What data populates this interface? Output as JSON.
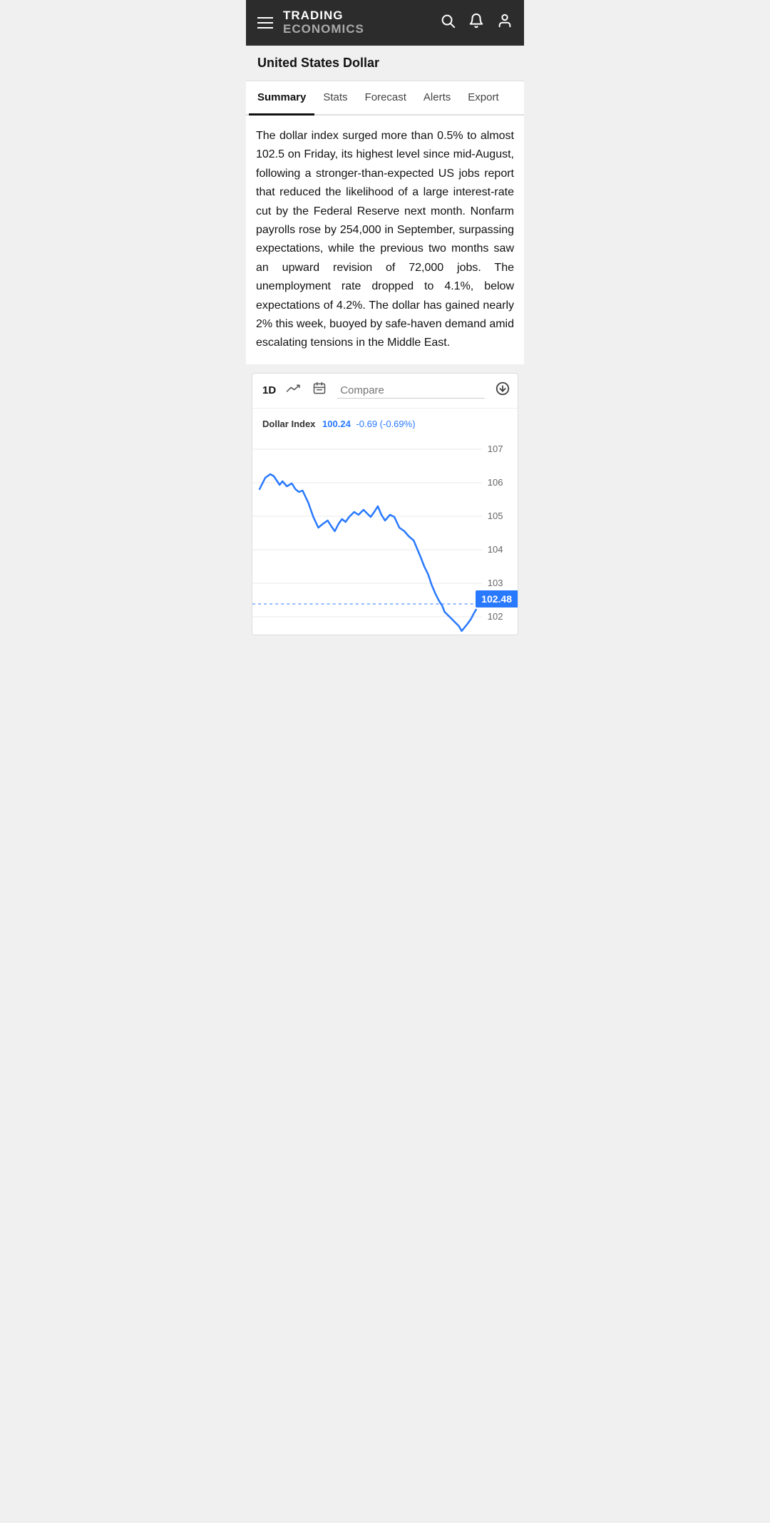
{
  "header": {
    "brand_trading": "TRADING",
    "brand_economics": "ECONOMICS"
  },
  "page": {
    "title": "United States Dollar"
  },
  "tabs": [
    {
      "label": "Summary",
      "active": true
    },
    {
      "label": "Stats",
      "active": false
    },
    {
      "label": "Forecast",
      "active": false
    },
    {
      "label": "Alerts",
      "active": false
    },
    {
      "label": "Export",
      "active": false
    }
  ],
  "summary": {
    "text": "The dollar index surged more than 0.5% to almost 102.5 on Friday, its highest level since mid-August, following a stronger-than-expected US jobs report that reduced the likelihood of a large interest-rate cut by the Federal Reserve next month. Nonfarm payrolls rose by 254,000 in September, surpassing expectations, while the previous two months saw an upward revision of 72,000 jobs. The unemployment rate dropped to 4.1%, below expectations of 4.2%. The dollar has gained nearly 2% this week, buoyed by safe-haven demand amid escalating tensions in the Middle East."
  },
  "chart": {
    "timeframe": "1D",
    "compare_placeholder": "Compare",
    "legend": {
      "name": "Dollar Index",
      "value": "100.24",
      "change": "-0.69 (-0.69%)"
    },
    "y_labels": [
      "107",
      "106",
      "105",
      "104",
      "103",
      "102"
    ],
    "current_price": "102.48",
    "accent_color": "#2979ff"
  },
  "icons": {
    "hamburger": "☰",
    "search": "🔍",
    "bell": "🔔",
    "user": "👤",
    "trend": "↗",
    "calendar": "📅",
    "download": "⬇",
    "more": "⋮"
  }
}
